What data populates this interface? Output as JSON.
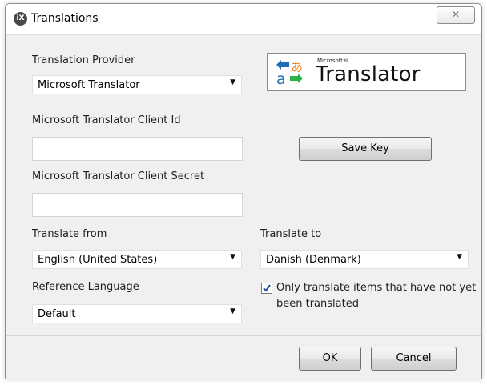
{
  "window": {
    "title": "Translations",
    "app_icon_text": "iX",
    "close_glyph": "✕"
  },
  "provider": {
    "label": "Translation Provider",
    "selected": "Microsoft Translator"
  },
  "logo": {
    "small_text": "Microsoft®",
    "big_text": "Translator"
  },
  "client_id": {
    "label": "Microsoft Translator Client Id",
    "value": ""
  },
  "client_secret": {
    "label": "Microsoft Translator Client Secret",
    "value": ""
  },
  "save_key_label": "Save Key",
  "translate_from": {
    "label": "Translate from",
    "selected": "English (United States)"
  },
  "translate_to": {
    "label": "Translate to",
    "selected": "Danish (Denmark)"
  },
  "reference_language": {
    "label": "Reference Language",
    "selected": "Default"
  },
  "only_untranslated": {
    "label": "Only translate items that have not yet been translated",
    "checked": true
  },
  "footer": {
    "ok_label": "OK",
    "cancel_label": "Cancel"
  },
  "colors": {
    "logo_blue": "#1f6db5",
    "logo_green": "#29b34a",
    "logo_orange": "#f58220",
    "check_blue": "#1c4e9c"
  },
  "icons": {
    "dropdown": "chevron-down-icon",
    "close": "close-icon"
  }
}
